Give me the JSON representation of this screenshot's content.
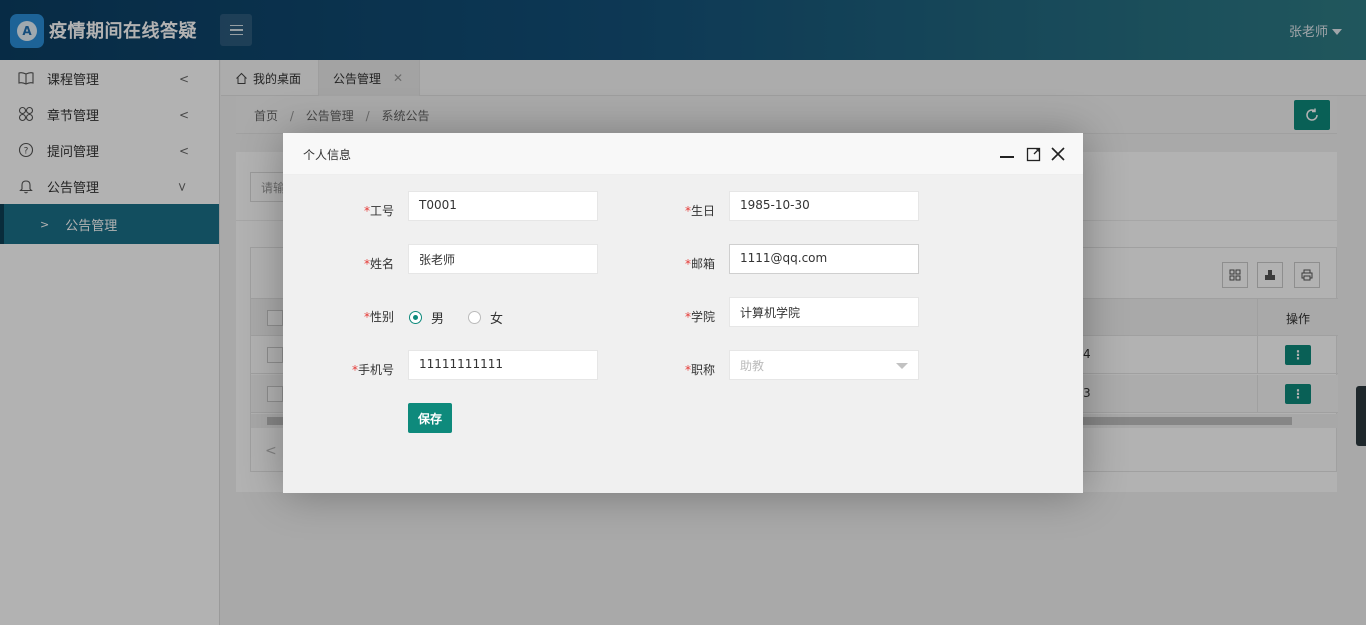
{
  "header": {
    "app_title": "疫情期间在线答疑",
    "logo_letter": "A",
    "user_name": "张老师"
  },
  "sidebar": {
    "items": [
      {
        "label": "课程管理",
        "icon": "book-icon"
      },
      {
        "label": "章节管理",
        "icon": "grid-icon"
      },
      {
        "label": "提问管理",
        "icon": "question-icon"
      },
      {
        "label": "公告管理",
        "icon": "bell-icon"
      }
    ],
    "sub_item": "公告管理"
  },
  "tabs": {
    "home": "我的桌面",
    "active": "公告管理"
  },
  "breadcrumb": {
    "home": "首页",
    "level1": "公告管理",
    "level2": "系统公告"
  },
  "search": {
    "placeholder": "请输"
  },
  "table": {
    "op_header": "操作",
    "rows": [
      {
        "num_fragment": "4"
      },
      {
        "num_fragment": "3"
      }
    ]
  },
  "modal": {
    "title": "个人信息",
    "fields": {
      "job_no": {
        "label": "工号",
        "value": "T0001"
      },
      "name": {
        "label": "姓名",
        "value": "张老师"
      },
      "gender": {
        "label": "性别",
        "male": "男",
        "female": "女",
        "selected": "男"
      },
      "phone": {
        "label": "手机号",
        "value": "11111111111"
      },
      "birthday": {
        "label": "生日",
        "value": "1985-10-30"
      },
      "email": {
        "label": "邮箱",
        "value": "1111@qq.com"
      },
      "college": {
        "label": "学院",
        "value": "计算机学院"
      },
      "title": {
        "label": "职称",
        "value": "助教"
      }
    },
    "save_label": "保存"
  },
  "colors": {
    "accent": "#0e8a7c",
    "sidebar_active": "#1b7089",
    "header_start": "#0b3e63",
    "required": "#e53935"
  }
}
